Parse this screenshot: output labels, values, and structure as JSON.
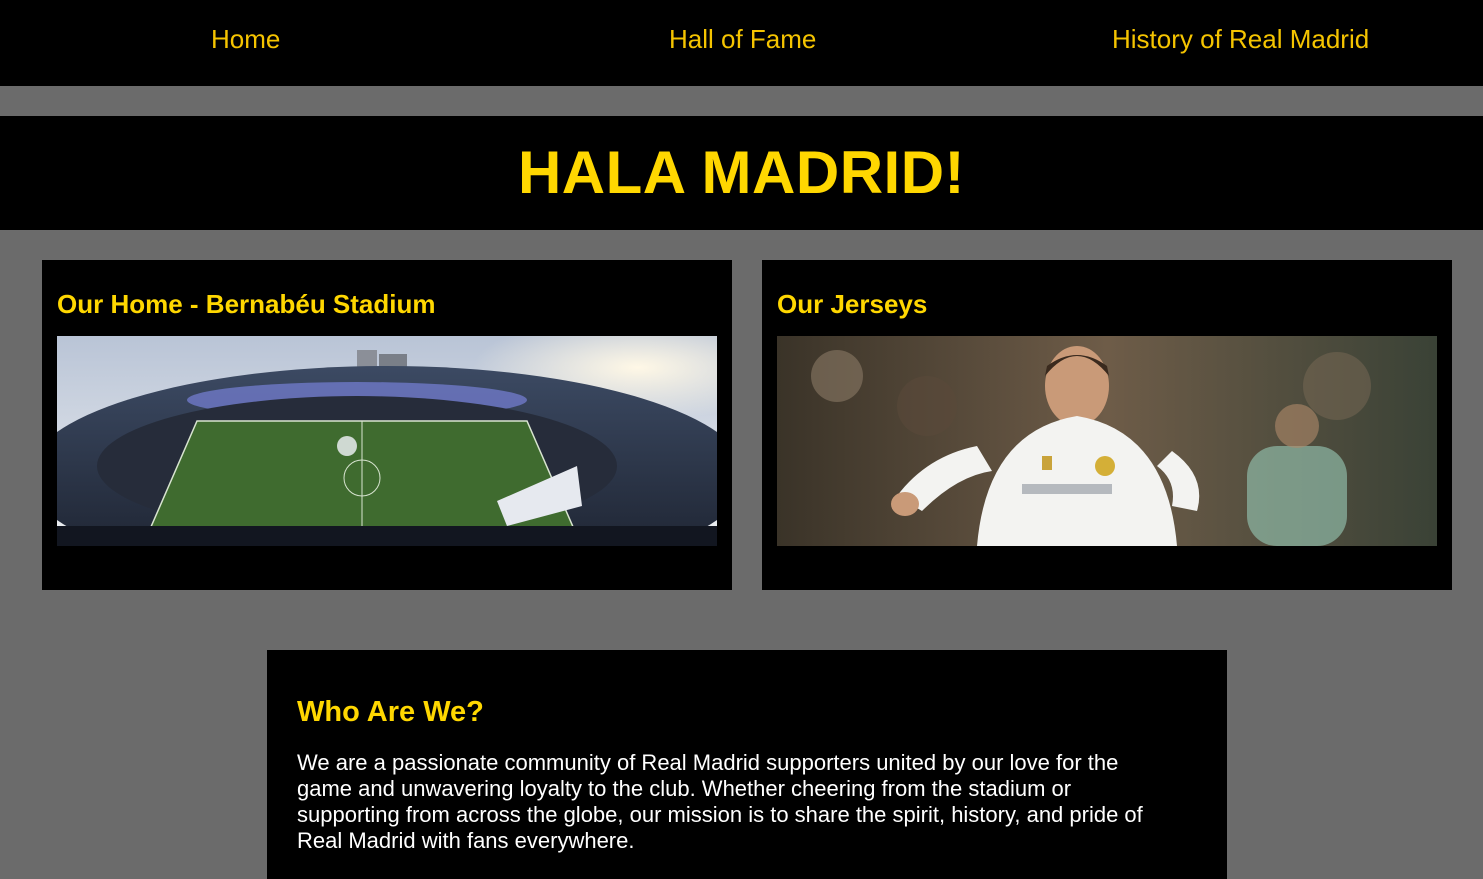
{
  "nav": {
    "items": [
      {
        "label": "Home"
      },
      {
        "label": "Hall of Fame"
      },
      {
        "label": "History of Real Madrid"
      }
    ]
  },
  "banner": {
    "title": "HALA MADRID!"
  },
  "cards": [
    {
      "title": "Our Home - Bernabéu Stadium",
      "image": "stadium-photo"
    },
    {
      "title": "Our Jerseys",
      "image": "player-jersey-photo"
    }
  ],
  "about": {
    "title": "Who Are We?",
    "text": "We are a passionate community of Real Madrid supporters united by our love for the game and unwavering loyalty to the club. Whether cheering from the stadium or supporting from across the globe, our mission is to share the spirit, history, and pride of Real Madrid with fans everywhere."
  },
  "colors": {
    "accent": "#ffd700",
    "nav_link": "#f5c400",
    "panel": "#000000",
    "page_bg": "#6b6b6b"
  }
}
